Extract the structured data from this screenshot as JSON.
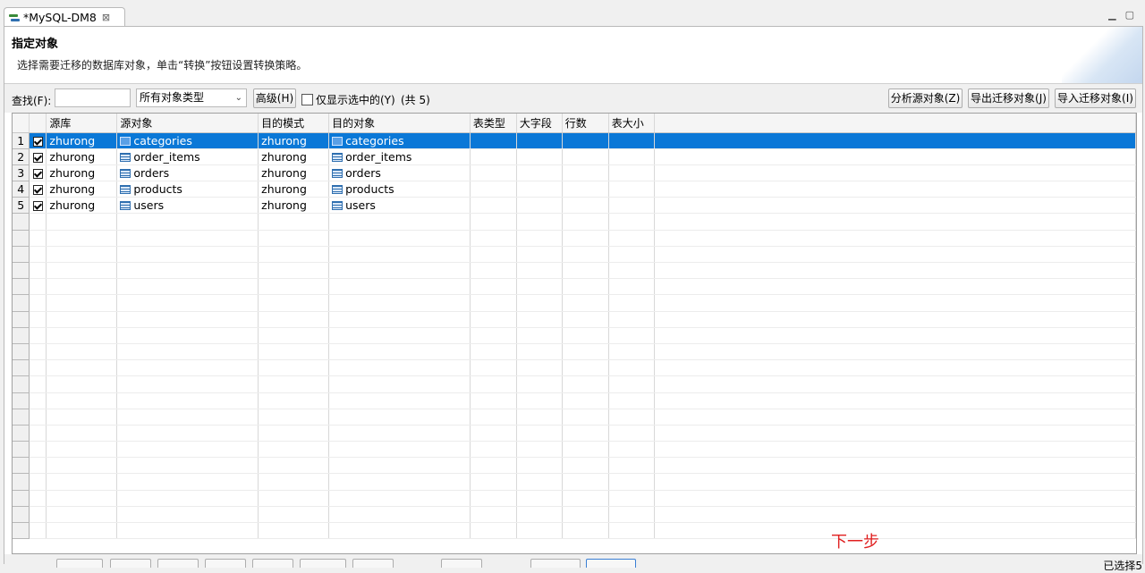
{
  "tab": {
    "title": "*MySQL-DM8",
    "icon": "migration-icon"
  },
  "header": {
    "title": "指定对象",
    "description": "选择需要迁移的数据库对象，单击“转换”按钮设置转换策略。"
  },
  "toolbar": {
    "find_label": "查找(F):",
    "find_value": "",
    "type_select": "所有对象类型",
    "advanced_button": "高级(H)",
    "only_selected_label": "仅显示选中的(Y)",
    "count": "(共 5)",
    "analyze_button": "分析源对象(Z)",
    "export_button": "导出迁移对象(J)",
    "import_button": "导入迁移对象(I)"
  },
  "grid": {
    "columns": [
      "源库",
      "源对象",
      "目的模式",
      "目的对象",
      "表类型",
      "大字段",
      "行数",
      "表大小"
    ],
    "rows": [
      {
        "no": "1",
        "checked": true,
        "src_db": "zhurong",
        "src_obj": "categories",
        "dst_schema": "zhurong",
        "dst_obj": "categories"
      },
      {
        "no": "2",
        "checked": true,
        "src_db": "zhurong",
        "src_obj": "order_items",
        "dst_schema": "zhurong",
        "dst_obj": "order_items"
      },
      {
        "no": "3",
        "checked": true,
        "src_db": "zhurong",
        "src_obj": "orders",
        "dst_schema": "zhurong",
        "dst_obj": "orders"
      },
      {
        "no": "4",
        "checked": true,
        "src_db": "zhurong",
        "src_obj": "products",
        "dst_schema": "zhurong",
        "dst_obj": "products"
      },
      {
        "no": "5",
        "checked": true,
        "src_db": "zhurong",
        "src_obj": "users",
        "dst_schema": "zhurong",
        "dst_obj": "users"
      }
    ],
    "selected_row": 0
  },
  "footer": {
    "next_annotation": "下一步",
    "selected_count": "已选择5"
  },
  "colors": {
    "selection": "#0a78d7",
    "annotation": "#e02020"
  }
}
